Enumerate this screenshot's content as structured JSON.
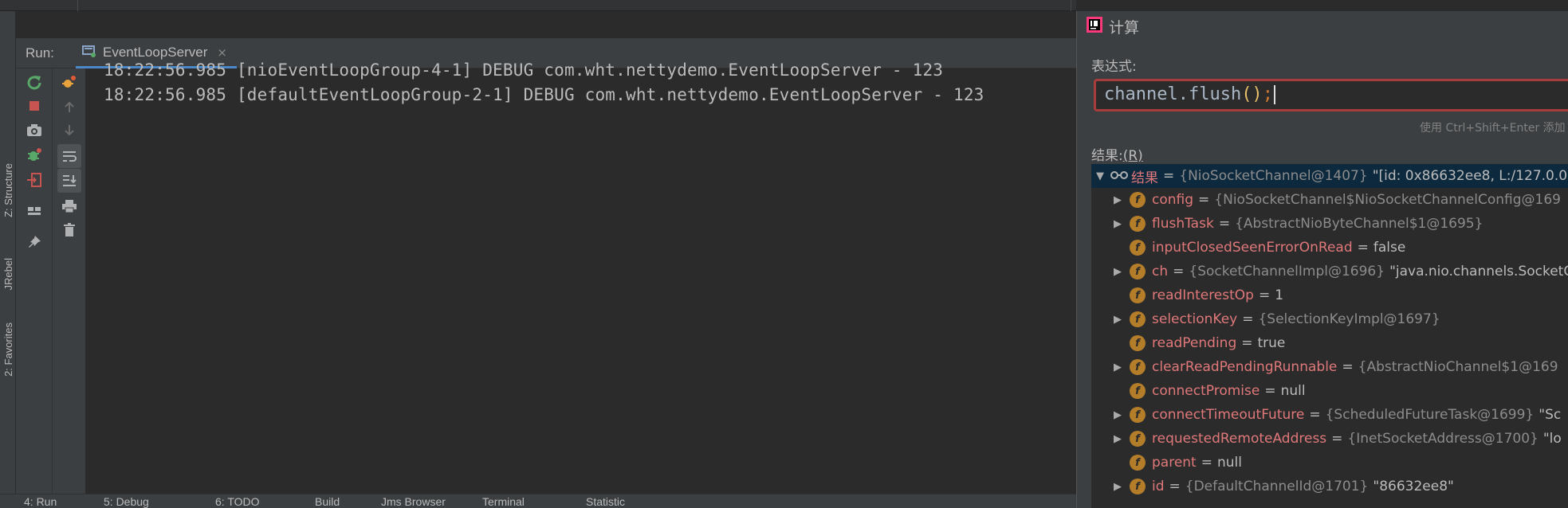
{
  "colors": {
    "accent_tab_underline": "#4a88c7",
    "expr_border_error": "#a63c3c",
    "field_name": "#e0787a",
    "field_icon": "#b37d29",
    "selection": "#0d293e",
    "rerun_green": "#59a869",
    "stop_red": "#c75450"
  },
  "run_panel": {
    "label": "Run:",
    "tab_label": "EventLoopServer",
    "tab_close": "×"
  },
  "left_strip": {
    "structure_tab": "Z: Structure",
    "jrebel_tab": "JRebel",
    "favorites_tab": "2: Favorites"
  },
  "toolbar_icons": [
    "rerun-icon",
    "stop-icon",
    "camera-icon",
    "debug-icon",
    "login-icon",
    "layout-icon",
    "pin-icon",
    "scroll-up-icon",
    "scroll-down-icon",
    "soft-wrap-icon",
    "scroll-to-end-icon",
    "print-icon",
    "trash-icon",
    "bug-icon"
  ],
  "console": {
    "lines": [
      "18:22:56.985 [nioEventLoopGroup-4-1] DEBUG com.wht.nettydemo.EventLoopServer - 123",
      "18:22:56.985 [defaultEventLoopGroup-2-1] DEBUG com.wht.nettydemo.EventLoopServer - 123"
    ]
  },
  "bottom_tabs": {
    "run": "4: Run",
    "debug": "5: Debug",
    "todo": "6: TODO",
    "build": "Build",
    "jrebel_browser": "Jms Browser",
    "terminal": "Terminal",
    "statistic": "Statistic"
  },
  "evaluate": {
    "title": "计算",
    "expression_label": "表达式:",
    "expression_code": "channel.flush",
    "expression_parens": "()",
    "expression_semicolon": ";",
    "hint": "使用 Ctrl+Shift+Enter 添加",
    "result_label": "结果:",
    "result_mnemonic": "(R)",
    "tree": [
      {
        "expandable": true,
        "expanded": true,
        "root": true,
        "name": "结果",
        "type": "{NioSocketChannel@1407}",
        "value": "\"[id: 0x86632ee8, L:/127.0.0."
      },
      {
        "expandable": true,
        "name": "config",
        "type": "{NioSocketChannel$NioSocketChannelConfig@169",
        "value": ""
      },
      {
        "expandable": true,
        "name": "flushTask",
        "type": "{AbstractNioByteChannel$1@1695}",
        "value": ""
      },
      {
        "expandable": false,
        "name": "inputClosedSeenErrorOnRead",
        "type": "",
        "value": "false"
      },
      {
        "expandable": true,
        "name": "ch",
        "type": "{SocketChannelImpl@1696}",
        "value": "\"java.nio.channels.SocketC"
      },
      {
        "expandable": false,
        "name": "readInterestOp",
        "type": "",
        "value": "1"
      },
      {
        "expandable": true,
        "name": "selectionKey",
        "type": "{SelectionKeyImpl@1697}",
        "value": ""
      },
      {
        "expandable": false,
        "name": "readPending",
        "type": "",
        "value": "true"
      },
      {
        "expandable": true,
        "name": "clearReadPendingRunnable",
        "type": "{AbstractNioChannel$1@169",
        "value": ""
      },
      {
        "expandable": false,
        "name": "connectPromise",
        "type": "",
        "value": "null"
      },
      {
        "expandable": true,
        "name": "connectTimeoutFuture",
        "type": "{ScheduledFutureTask@1699}",
        "value": "\"Sc"
      },
      {
        "expandable": true,
        "name": "requestedRemoteAddress",
        "type": "{InetSocketAddress@1700}",
        "value": "\"lo"
      },
      {
        "expandable": false,
        "name": "parent",
        "type": "",
        "value": "null"
      },
      {
        "expandable": true,
        "name": "id",
        "type": "{DefaultChannelId@1701}",
        "value": "\"86632ee8\""
      }
    ]
  }
}
